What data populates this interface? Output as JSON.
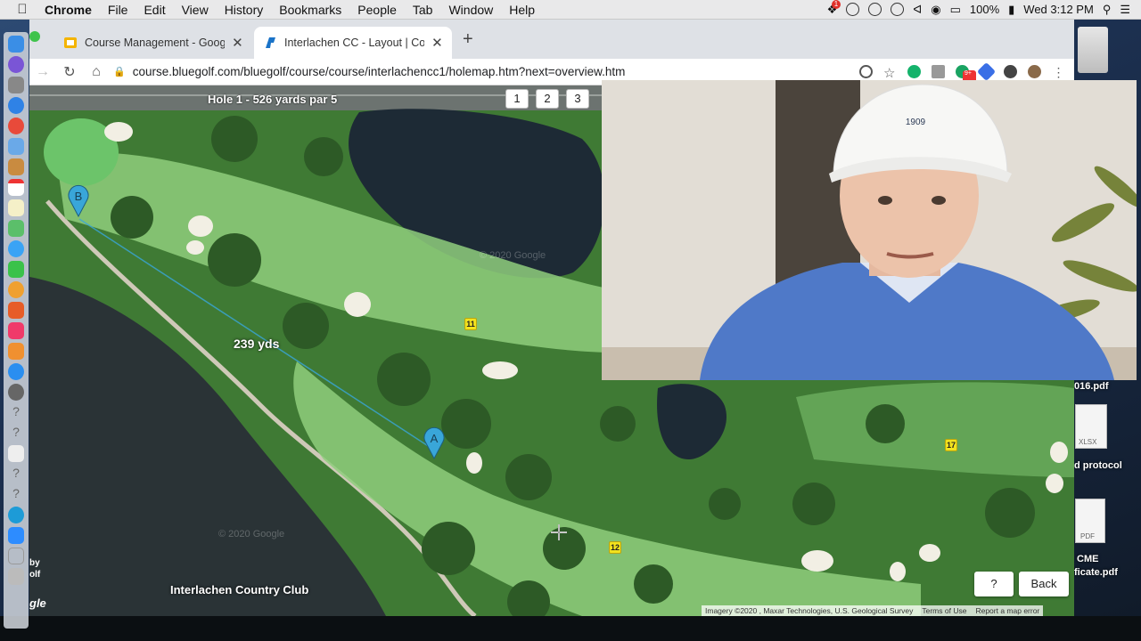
{
  "menubar": {
    "app_name": "Chrome",
    "menus": [
      "File",
      "Edit",
      "View",
      "History",
      "Bookmarks",
      "People",
      "Tab",
      "Window",
      "Help"
    ],
    "battery": "100%",
    "clock": "Wed 3:12 PM",
    "notification_count": "1"
  },
  "browser": {
    "tabs": [
      {
        "title": "Course Management - Google"
      },
      {
        "title": "Interlachen CC - Layout | Cour"
      }
    ],
    "url": "course.bluegolf.com/bluegolf/course/course/interlachencc1/holemap.htm?next=overview.htm",
    "ext_badge": "9+"
  },
  "map": {
    "hole_title": "Hole 1 - 526 yards par 5",
    "hole_buttons": [
      "1",
      "2",
      "3"
    ],
    "distance_label": "239 yds",
    "marker_a": "A",
    "marker_b": "B",
    "hole_markers": [
      "11",
      "12",
      "17"
    ],
    "club_name": "Interlachen Country Club",
    "help_label": "?",
    "back_label": "Back",
    "google_logo_fragment": "gle",
    "side_fragment": "by\nolf",
    "watermark": "© 2020 Google",
    "attribution": {
      "imagery": "Imagery ©2020 , Maxar Technologies, U.S. Geological Survey",
      "terms": "Terms of Use",
      "report": "Report a map error"
    }
  },
  "webcam": {
    "cap_logo_text": "1909"
  },
  "desktop_files": [
    {
      "label": "016.pdf"
    },
    {
      "label": "XLSX"
    },
    {
      "label": "d protocol"
    },
    {
      "label": "PDF"
    },
    {
      "label": "CME"
    },
    {
      "label": "ficate.pdf"
    }
  ],
  "colors": {
    "fairway": "#8fce7c",
    "rough": "#4f8a3f",
    "water": "#1d2a35",
    "marker": "#39a6d9",
    "chrome_tab_bar": "#dee1e6"
  }
}
